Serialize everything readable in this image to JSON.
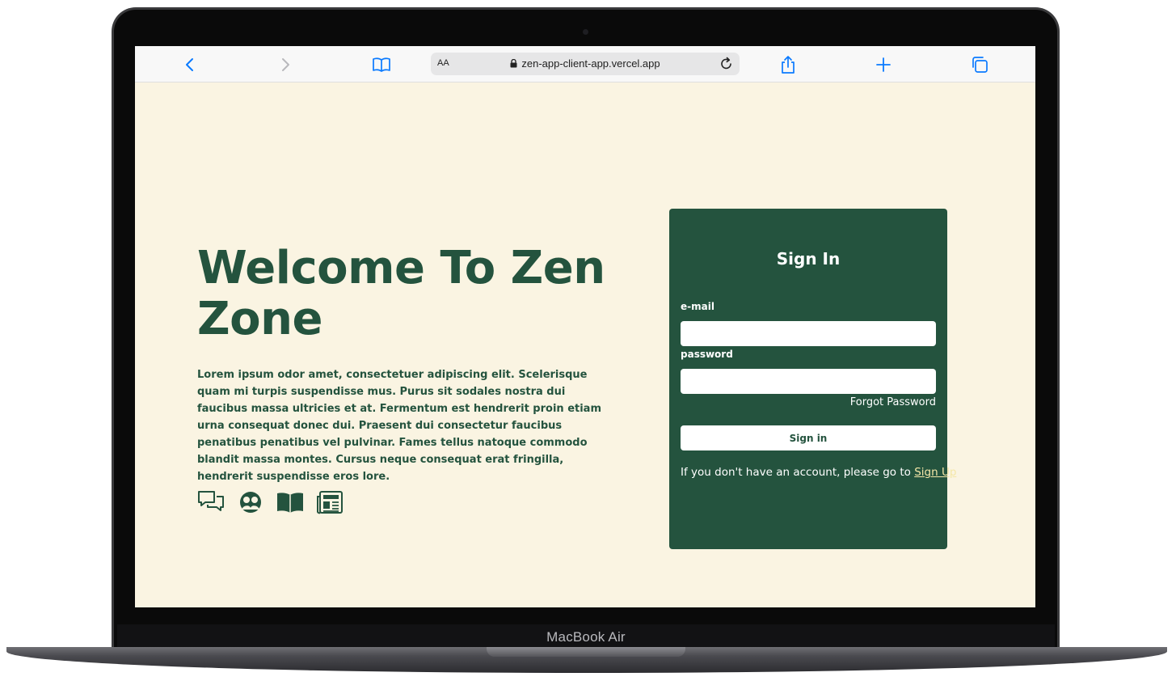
{
  "device": {
    "brand_label": "MacBook Air"
  },
  "browser": {
    "text_size_label": "AA",
    "url": "zen-app-client-app.vercel.app",
    "icons": [
      "back-icon",
      "forward-icon",
      "bookmarks-icon",
      "lock-icon",
      "reload-icon",
      "share-icon",
      "new-tab-icon",
      "tabs-icon"
    ],
    "accent_color": "#0a7aff"
  },
  "hero": {
    "title": "Welcome To Zen Zone",
    "body": "Lorem ipsum odor amet, consectetuer adipiscing elit. Scelerisque quam mi turpis suspendisse mus. Purus sit sodales nostra dui faucibus massa ultricies et at. Fermentum est hendrerit proin etiam urna consequat donec dui. Praesent dui consectetur faucibus penatibus penatibus vel pulvinar. Fames tellus natoque commodo blandit massa montes. Cursus neque consequat erat fringilla, hendrerit suspendisse eros lore.",
    "feature_icons": [
      "chat-bubbles-icon",
      "community-icon",
      "book-icon",
      "newspaper-icon"
    ]
  },
  "signin": {
    "title": "Sign In",
    "email_label": "e-mail",
    "email_value": "",
    "password_label": "password",
    "password_value": "",
    "forgot_label": "Forgot Password",
    "submit_label": "Sign in",
    "signup_prompt": "If you don't have an account, please go to ",
    "signup_link": "Sign Up"
  },
  "colors": {
    "page_background": "#faf4e2",
    "brand_green": "#24533e",
    "link_highlight": "#f4e7a8"
  }
}
